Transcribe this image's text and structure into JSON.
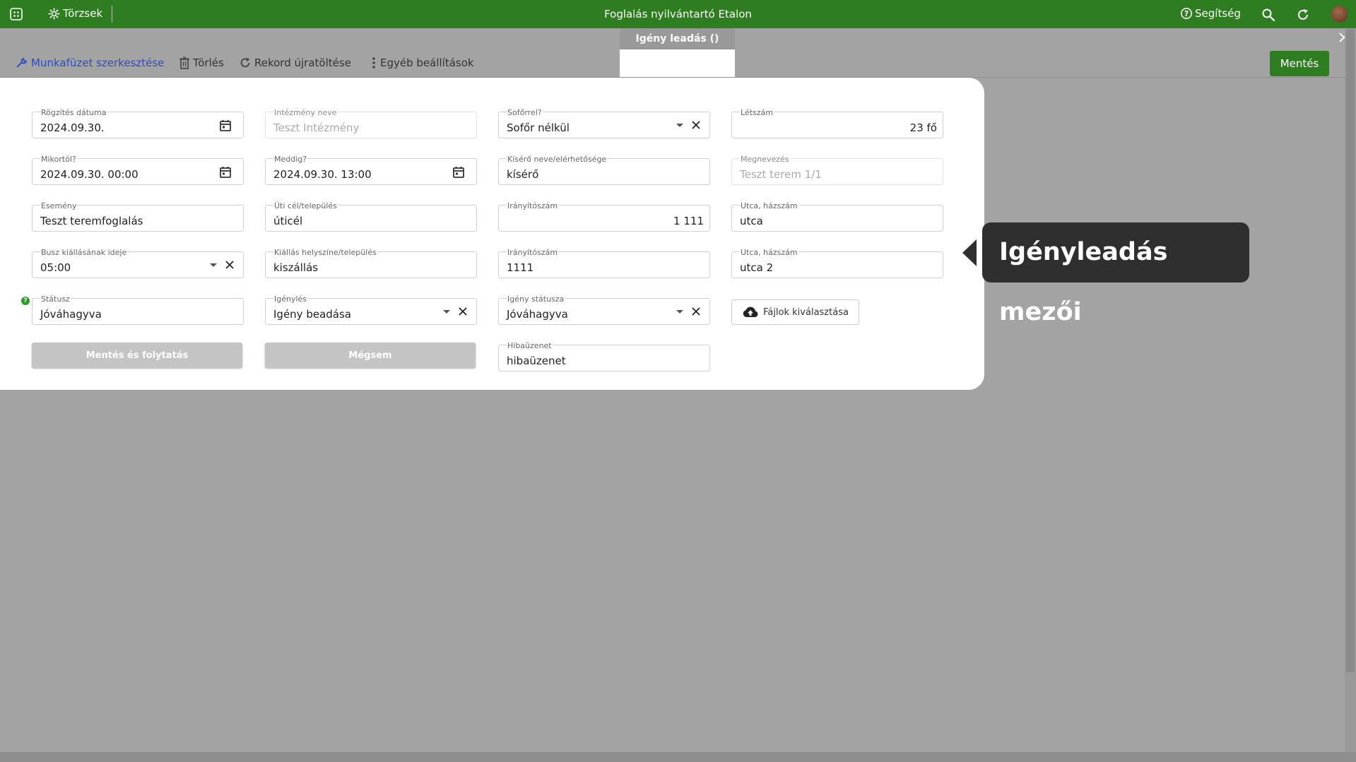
{
  "topbar": {
    "torzsek_label": "Törzsek",
    "app_title": "Foglalás nyilvántartó Etalon",
    "help_label": "Segítség"
  },
  "tab": {
    "active_label": "Igény leadás ()"
  },
  "toolbar": {
    "edit_workbook": "Munkafüzet szerkesztése",
    "delete": "Törlés",
    "reload": "Rekord újratöltése",
    "more_settings": "Egyéb beállítások",
    "save": "Mentés"
  },
  "form": {
    "rogzites_datuma": {
      "label": "Rögzítés dátuma",
      "value": "2024.09.30."
    },
    "intezmeny_neve": {
      "label": "Intézmény neve",
      "value": "Teszt Intézmény"
    },
    "soforrel": {
      "label": "Sofőrrel?",
      "value": "Sofőr nélkül"
    },
    "letszam": {
      "label": "Létszám",
      "value": "23 fő"
    },
    "mikortol": {
      "label": "Mikortól?",
      "value": "2024.09.30. 00:00"
    },
    "meddig": {
      "label": "Meddig?",
      "value": "2024.09.30. 13:00"
    },
    "kisero": {
      "label": "Kísérő neve/elérhetősége",
      "value": "kísérő"
    },
    "megnevezes": {
      "label": "Megnevezés",
      "value": "Teszt terem 1/1"
    },
    "esemeny": {
      "label": "Esemény",
      "value": "Teszt teremfoglalás"
    },
    "uti_cel": {
      "label": "Úti cél/település",
      "value": "úticél"
    },
    "iranyitoszam1": {
      "label": "Irányítószám",
      "value": "1 111"
    },
    "utca1": {
      "label": "Utca, házszám",
      "value": "utca"
    },
    "busz_kiallas": {
      "label": "Busz kiállásának ideje",
      "value": "05:00"
    },
    "kiallas_helyszin": {
      "label": "Kiállás helyszíne/település",
      "value": "kiszállás"
    },
    "iranyitoszam2": {
      "label": "Irányítószám",
      "value": "1111"
    },
    "utca2": {
      "label": "Utca, házszám",
      "value": "utca 2"
    },
    "statusz": {
      "label": "Státusz",
      "value": "Jóváhagyva"
    },
    "igenyles": {
      "label": "Igénylés",
      "value": "Igény beadása"
    },
    "igeny_statusza": {
      "label": "Igény státusza",
      "value": "Jóváhagyva"
    },
    "upload_label": "Fájlok kiválasztása",
    "save_continue": "Mentés és folytatás",
    "cancel": "Mégsem",
    "hibauzenet": {
      "label": "Hibaüzenet",
      "value": "hibaüzenet"
    }
  },
  "tooltip": {
    "text": "Igényleadás mezői"
  },
  "colors": {
    "brand_green": "#2e7d20",
    "tooltip_bg": "#2f2f2f"
  }
}
